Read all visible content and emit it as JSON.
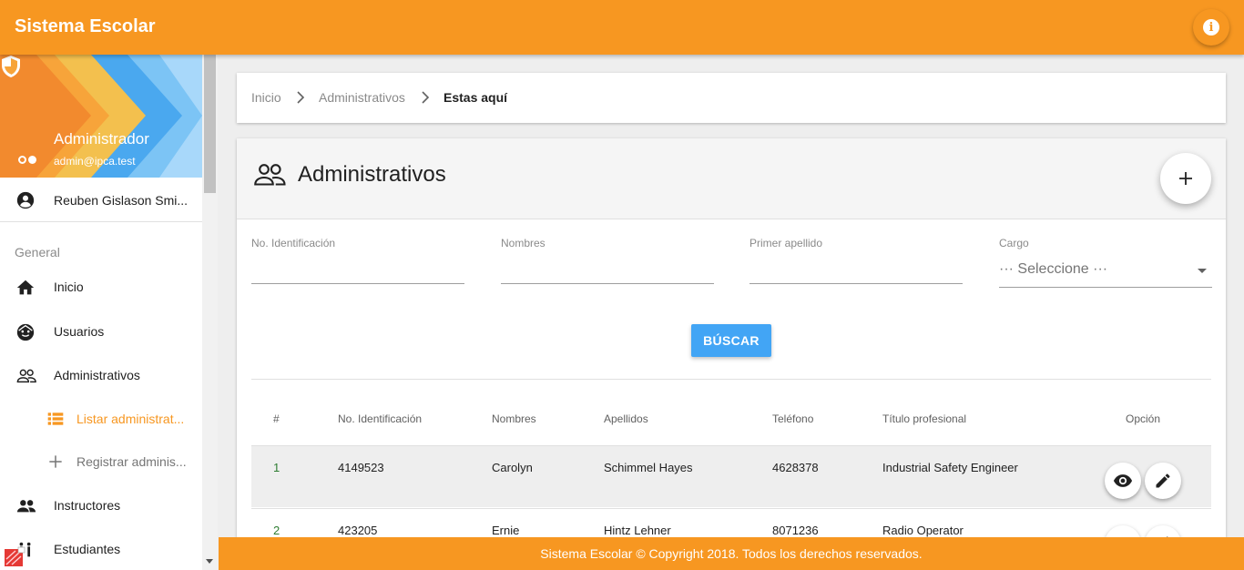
{
  "app": {
    "title": "Sistema Escolar"
  },
  "profile": {
    "name": "Administrador",
    "email": "admin@ipca.test",
    "user": "Reuben Gislason Smi..."
  },
  "sidebar": {
    "section": "General",
    "items": [
      {
        "label": "Inicio",
        "icon": "home-icon"
      },
      {
        "label": "Usuarios",
        "icon": "face-icon"
      },
      {
        "label": "Administrativos",
        "icon": "people-outline-icon"
      },
      {
        "label": "Listar administrat...",
        "icon": "list-icon",
        "active": true
      },
      {
        "label": "Registrar adminis...",
        "icon": "plus-icon"
      },
      {
        "label": "Instructores",
        "icon": "people-icon"
      },
      {
        "label": "Estudiantes",
        "icon": "students-icon"
      }
    ]
  },
  "breadcrumb": {
    "items": [
      "Inicio",
      "Administrativos"
    ],
    "current": "Estas aquí"
  },
  "page": {
    "title": "Administrativos"
  },
  "filters": {
    "id_label": "No. Identificación",
    "names_label": "Nombres",
    "lastname_label": "Primer apellido",
    "cargo_label": "Cargo",
    "cargo_value": "··· Seleccione ···",
    "search_button": "BÚSCAR"
  },
  "table": {
    "headers": [
      "#",
      "No. Identificación",
      "Nombres",
      "Apellidos",
      "Teléfono",
      "Título profesional",
      "Opción"
    ],
    "rows": [
      {
        "index": "1",
        "id": "4149523",
        "names": "Carolyn",
        "lastnames": "Schimmel Hayes",
        "phone": "4628378",
        "title": "Industrial Safety Engineer"
      },
      {
        "index": "2",
        "id": "423205",
        "names": "Ernie",
        "lastnames": "Hintz Lehner",
        "phone": "8071236",
        "title": "Radio Operator"
      }
    ]
  },
  "footer": {
    "text": "Sistema Escolar © Copyright 2018. Todos los derechos reservados."
  },
  "colors": {
    "primary": "#f79721",
    "accent": "#42a5f5"
  }
}
